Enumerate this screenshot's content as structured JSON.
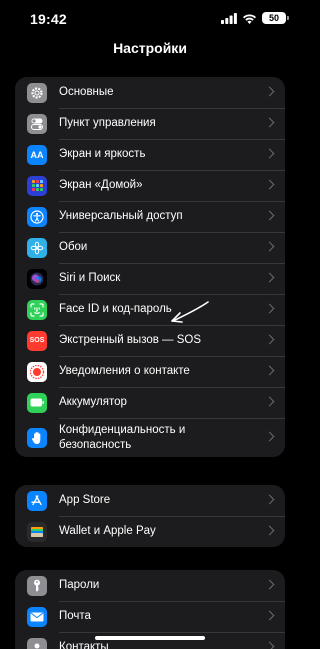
{
  "status": {
    "time": "19:42",
    "battery": "50"
  },
  "title": "Настройки",
  "group1": [
    {
      "label": "Основные",
      "icon": "gear-icon",
      "color": "#8e8e93"
    },
    {
      "label": "Пункт управления",
      "icon": "toggles-icon",
      "color": "#8e8e93"
    },
    {
      "label": "Экран и яркость",
      "icon": "text-size-icon",
      "color": "#0a84ff"
    },
    {
      "label": "Экран «Домой»",
      "icon": "home-grid-icon",
      "color": "#2c3fd6"
    },
    {
      "label": "Универсальный доступ",
      "icon": "accessibility-icon",
      "color": "#0a84ff"
    },
    {
      "label": "Обои",
      "icon": "flower-icon",
      "color": "#2fb0e8"
    },
    {
      "label": "Siri и Поиск",
      "icon": "siri-icon",
      "color": "#1a1a2e"
    },
    {
      "label": "Face ID и код-пароль",
      "icon": "face-id-icon",
      "color": "#30d158"
    },
    {
      "label": "Экстренный вызов — SOS",
      "icon": "sos-icon",
      "color": "#ff3b30"
    },
    {
      "label": "Уведомления о контакте",
      "icon": "exposure-icon",
      "color": "#ff3b30"
    },
    {
      "label": "Аккумулятор",
      "icon": "battery-icon",
      "color": "#30d158"
    },
    {
      "label": "Конфиденциальность и безопасность",
      "icon": "hand-icon",
      "color": "#0a84ff"
    }
  ],
  "group2": [
    {
      "label": "App Store",
      "icon": "app-store-icon",
      "color": "#0a84ff"
    },
    {
      "label": "Wallet и Apple Pay",
      "icon": "wallet-icon",
      "color": "#1c1c1e"
    }
  ],
  "group3": [
    {
      "label": "Пароли",
      "icon": "key-icon",
      "color": "#8e8e93"
    },
    {
      "label": "Почта",
      "icon": "mail-icon",
      "color": "#0a84ff"
    },
    {
      "label": "Контакты",
      "icon": "contacts-icon",
      "color": "#8e8e93"
    }
  ],
  "icon_text": {
    "text_size": "AA",
    "sos": "SOS"
  }
}
